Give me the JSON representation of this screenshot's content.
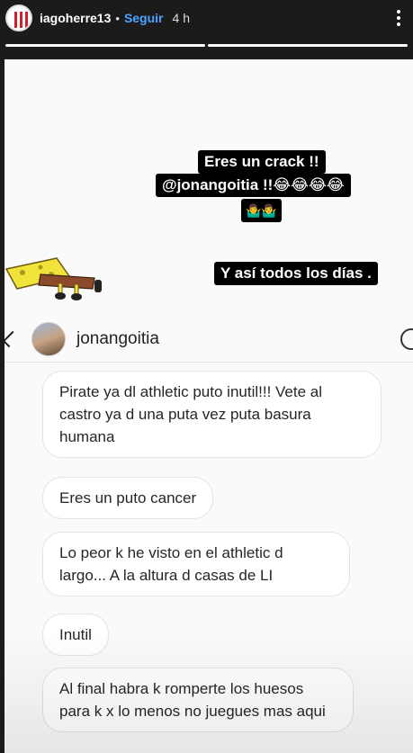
{
  "header": {
    "username": "iagoherre13",
    "separator": "•",
    "follow_label": "Seguir",
    "time_ago": "4 h"
  },
  "progress": [
    {
      "state": "viewed",
      "fill": 1.0
    },
    {
      "state": "current",
      "fill": 1.0
    }
  ],
  "stickers": {
    "line1": "Eres un crack !!",
    "line2": "@jonangoitia !!😂😂😂😂",
    "line3": "🤷‍♂️🤷‍♂️",
    "line4": "Y así todos los días ."
  },
  "dm": {
    "name": "jonangoitia",
    "messages": [
      "Pirate ya dl athletic puto inutil!!! Vete al castro ya d una puta vez puta basura humana",
      "Eres un puto cancer",
      "Lo peor k he visto en el athletic d largo... A la altura d casas de LI",
      "Inutil",
      "Al final habra k romperte los huesos para k x lo menos no juegues mas aqui"
    ]
  },
  "colors": {
    "follow": "#4aa3ff",
    "sticker_bg": "#000000",
    "bubble_border": "#e3e3e3"
  }
}
